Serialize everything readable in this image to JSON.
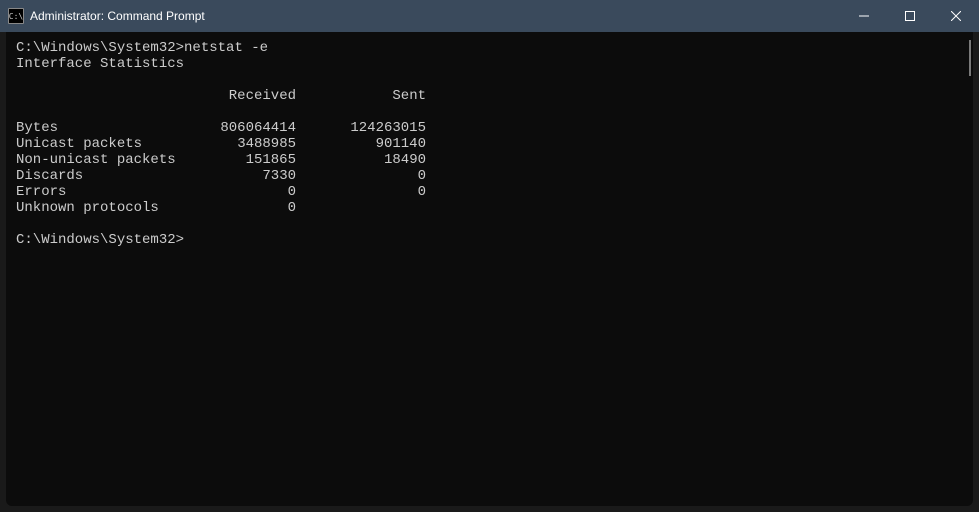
{
  "window": {
    "title": "Administrator: Command Prompt"
  },
  "terminal": {
    "prompt1_path": "C:\\Windows\\System32>",
    "prompt1_cmd": "netstat -e",
    "heading": "Interface Statistics",
    "col_received": "Received",
    "col_sent": "Sent",
    "rows": [
      {
        "label": "Bytes",
        "received": "806064414",
        "sent": "124263015"
      },
      {
        "label": "Unicast packets",
        "received": "3488985",
        "sent": "901140"
      },
      {
        "label": "Non-unicast packets",
        "received": "151865",
        "sent": "18490"
      },
      {
        "label": "Discards",
        "received": "7330",
        "sent": "0"
      },
      {
        "label": "Errors",
        "received": "0",
        "sent": "0"
      },
      {
        "label": "Unknown protocols",
        "received": "0",
        "sent": ""
      }
    ],
    "prompt2_path": "C:\\Windows\\System32>"
  }
}
